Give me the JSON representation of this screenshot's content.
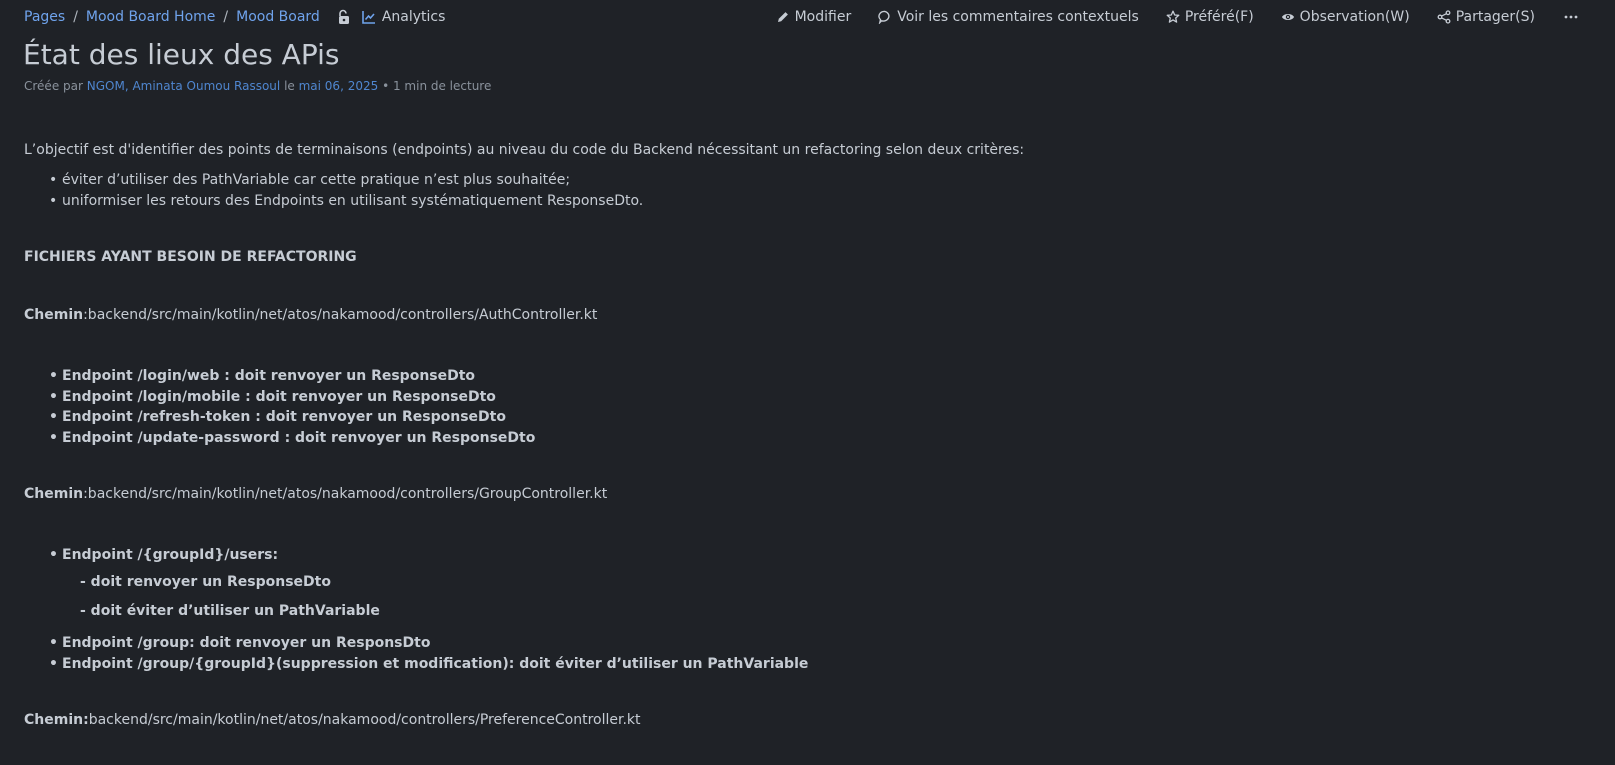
{
  "breadcrumb": {
    "items": [
      "Pages",
      "Mood Board Home",
      "Mood Board"
    ],
    "analytics": "Analytics"
  },
  "actions": {
    "edit": "Modifier",
    "comments": "Voir les commentaires contextuels",
    "favorite": "Préféré(F)",
    "watch": "Observation(W)",
    "share": "Partager(S)"
  },
  "page": {
    "title": "État des lieux des APis",
    "byline": {
      "created_by": "Créée par",
      "author": "NGOM, Aminata Oumou Rassoul",
      "on": "le",
      "date": "mai 06, 2025",
      "read_time": "• 1 min de lecture"
    }
  },
  "content": {
    "intro": "L’objectif est d'identifier des points de terminaisons (endpoints) au niveau du code du Backend nécessitant un refactoring selon deux critères:",
    "criteria": [
      "éviter d’utiliser des PathVariable car cette pratique n’est plus souhaitée;",
      "uniformiser les retours des Endpoints en utilisant systématiquement ResponseDto."
    ],
    "section_title": "FICHIERS AYANT BESOIN DE REFACTORING",
    "path_label": "Chemin",
    "path_label_colon": "Chemin:",
    "file1": {
      "path": ":backend/src/main/kotlin/net/atos/nakamood/controllers/AuthController.kt",
      "endpoints": [
        "Endpoint /login/web : doit renvoyer un ResponseDto",
        "Endpoint /login/mobile : doit renvoyer un ResponseDto",
        "Endpoint /refresh-token : doit renvoyer un ResponseDto",
        "Endpoint /update-password : doit renvoyer un ResponseDto"
      ]
    },
    "file2": {
      "path": ":backend/src/main/kotlin/net/atos/nakamood/controllers/GroupController.kt",
      "endpoint_first": "Endpoint /{groupId}/users:",
      "sub_items": [
        "- doit renvoyer un ResponseDto",
        "- doit éviter d’utiliser un PathVariable"
      ],
      "endpoints": [
        "Endpoint /group: doit renvoyer un ResponsDto",
        "Endpoint /group/{groupId}(suppression et modification): doit éviter d’utiliser un PathVariable"
      ]
    },
    "file3": {
      "path": "backend/src/main/kotlin/net/atos/nakamood/controllers/PreferenceController.kt"
    }
  }
}
